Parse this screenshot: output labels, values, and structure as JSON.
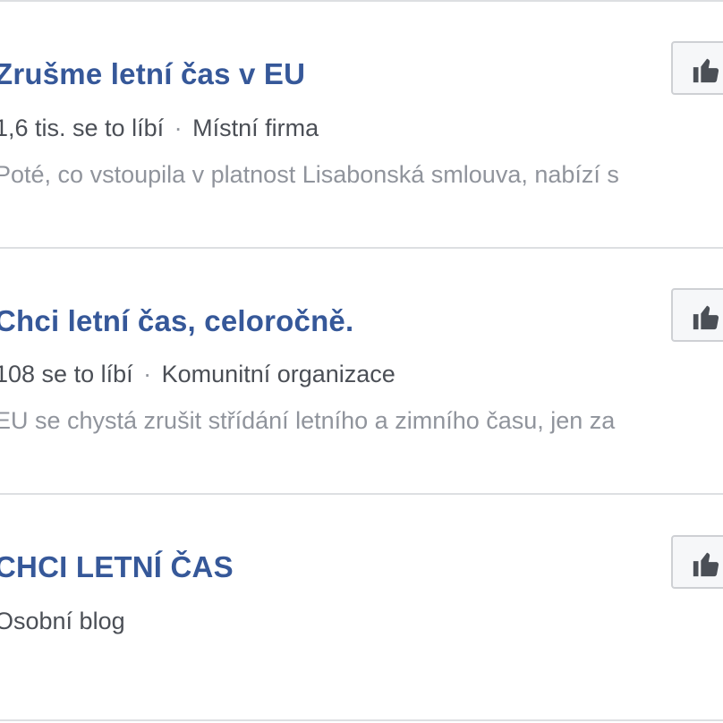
{
  "results": [
    {
      "title": "Zrušme letní čas v EU",
      "likes": "1,6 tis. se to líbí",
      "separator": "·",
      "category": "Místní firma",
      "snippet": "Poté, co vstoupila v platnost Lisabonská smlouva, nabízí s",
      "like_icon": "thumbs-up-icon"
    },
    {
      "title": "Chci letní čas, celoročně.",
      "likes": "108 se to líbí",
      "separator": "·",
      "category": "Komunitní organizace",
      "snippet": "EU se chystá zrušit střídání letního a zimního času, jen za",
      "like_icon": "thumbs-up-icon"
    },
    {
      "title": "CHCI LETNÍ ČAS",
      "category": "Osobní blog",
      "like_icon": "thumbs-up-icon"
    }
  ],
  "colors": {
    "title": "#365899",
    "meta": "#4b4f56",
    "snippet": "#90949c",
    "divider": "#dddfe2",
    "button_bg": "#f6f7f9",
    "button_border": "#ced0d4",
    "icon": "#4b4f56"
  }
}
